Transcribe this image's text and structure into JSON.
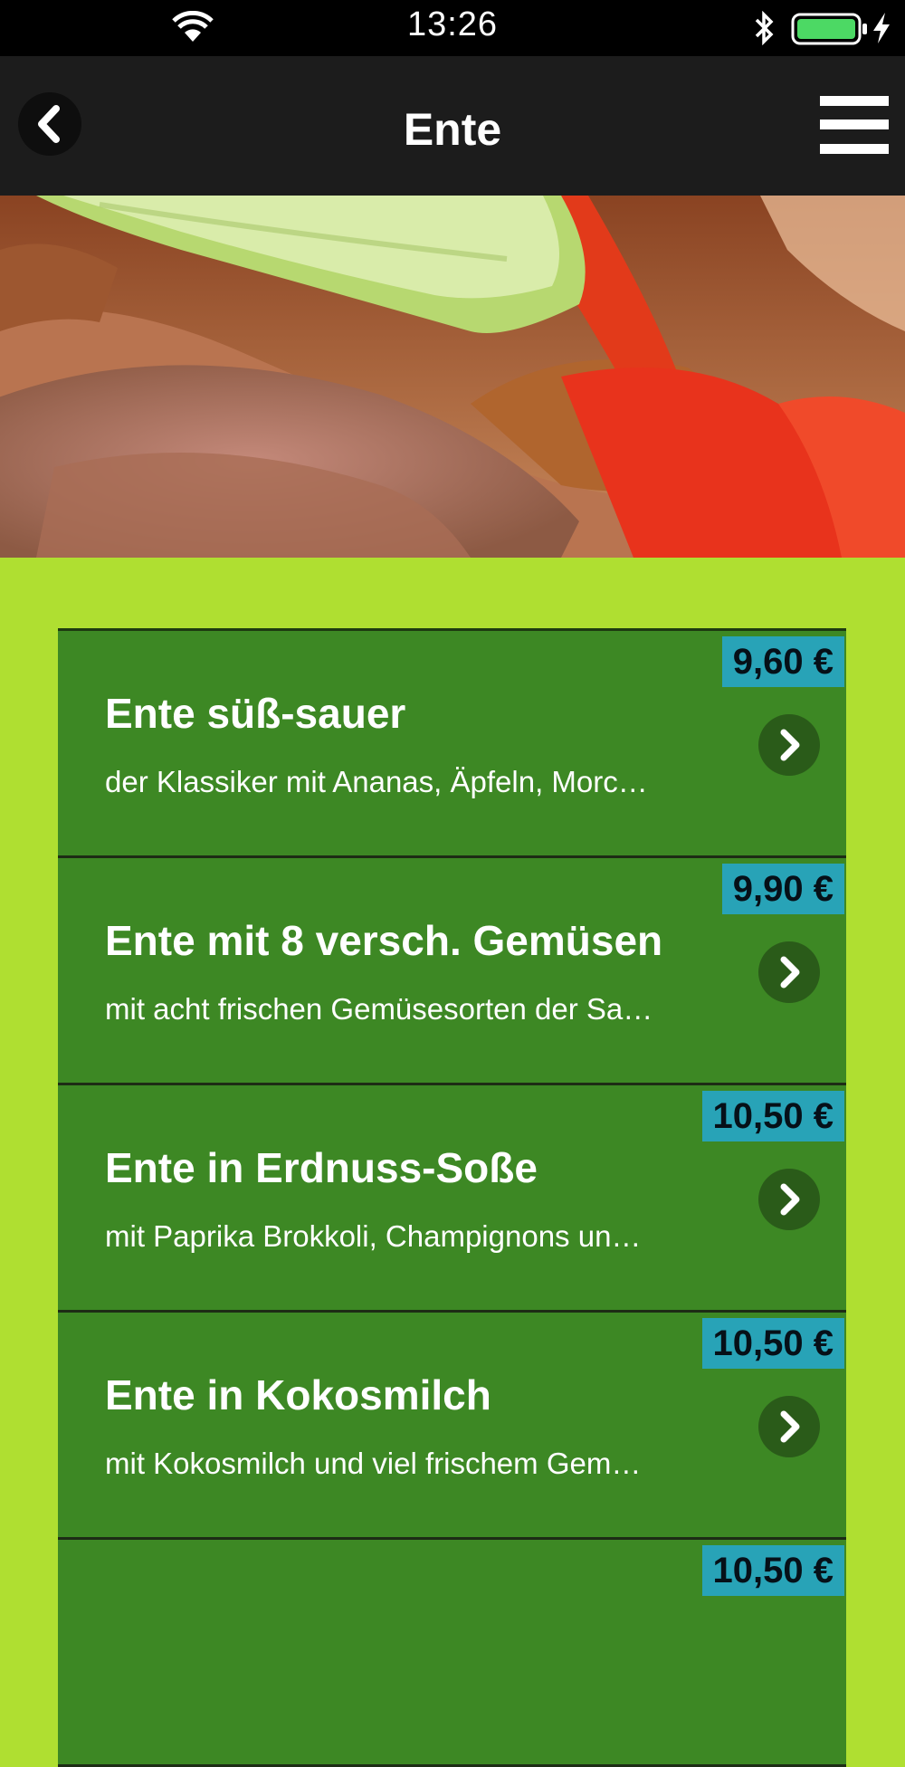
{
  "status_bar": {
    "time": "13:26",
    "icons": [
      "wifi-icon",
      "bluetooth-icon",
      "battery-icon",
      "charging-icon"
    ]
  },
  "nav": {
    "title": "Ente",
    "back_icon": "chevron-left-icon",
    "menu_icon": "hamburger-menu-icon"
  },
  "colors": {
    "background": "#afdf31",
    "item_background": "#3d8824",
    "price_badge": "#28a3b7",
    "nav_bar": "#1c1c1c"
  },
  "items": [
    {
      "title": "Ente süß-sauer",
      "description": "der Klassiker mit Ananas, Äpfeln, Morc…",
      "price": "9,60 €"
    },
    {
      "title": "Ente mit 8 versch. Gemüsen",
      "description": "mit acht frischen Gemüsesorten der Sa…",
      "price": "9,90 €"
    },
    {
      "title": "Ente in Erdnuss-Soße",
      "description": "mit Paprika Brokkoli, Champignons un…",
      "price": "10,50 €"
    },
    {
      "title": "Ente in Kokosmilch",
      "description": "mit Kokosmilch und viel frischem Gem…",
      "price": "10,50 €"
    },
    {
      "title": "",
      "description": "",
      "price": "10,50 €"
    }
  ]
}
